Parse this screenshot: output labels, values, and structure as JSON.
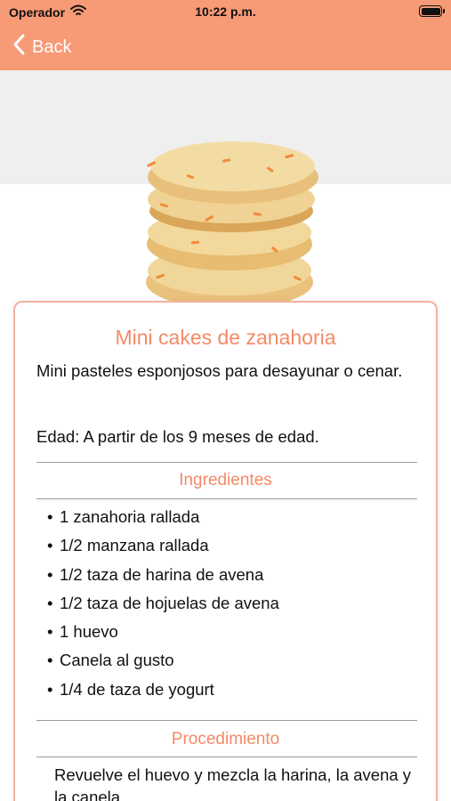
{
  "status": {
    "carrier": "Operador",
    "time": "10:22 p.m."
  },
  "nav": {
    "back_label": "Back"
  },
  "recipe": {
    "title": "Mini cakes de zanahoria",
    "description": "Mini pasteles esponjosos para desayunar o cenar.",
    "age": "Edad: A partir de los 9 meses de edad.",
    "ingredients_title": "Ingredientes",
    "ingredients": [
      "1 zanahoria rallada",
      "1/2 manzana rallada",
      "1/2 taza de harina de avena",
      "1/2 taza de hojuelas de avena",
      "1 huevo",
      "Canela al gusto",
      "1/4 de taza de yogurt"
    ],
    "procedure_title": "Procedimiento",
    "procedure_text": "Revuelve el huevo y mezcla la harina, la avena y la canela."
  },
  "colors": {
    "header": "#f79a76",
    "accent_text": "#f48a67",
    "card_border": "#f3b39c"
  }
}
